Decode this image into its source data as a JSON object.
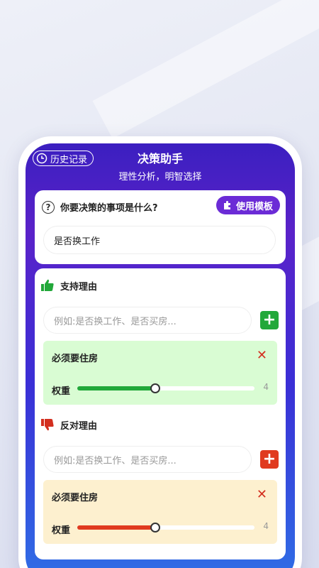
{
  "header": {
    "history_label": "历史记录",
    "title": "决策助手",
    "subtitle": "理性分析，明智选择"
  },
  "question": {
    "label": "你要决策的事项是什么?",
    "template_button": "使用模板",
    "value": "是否换工作"
  },
  "pros": {
    "title": "支持理由",
    "placeholder": "例如:是否换工作、是否买房...",
    "add_label": "+",
    "items": [
      {
        "text": "必须要住房",
        "weight_label": "权重",
        "weight": 4,
        "slider_fraction": 0.44
      }
    ]
  },
  "cons": {
    "title": "反对理由",
    "placeholder": "例如:是否换工作、是否买房...",
    "add_label": "+",
    "items": [
      {
        "text": "必须要住房",
        "weight_label": "权重",
        "weight": 4,
        "slider_fraction": 0.44
      }
    ]
  },
  "colors": {
    "accent": "#6b2bd6",
    "pro": "#22a83a",
    "con": "#e03a1f",
    "pro_bg": "#d9fcd3",
    "con_bg": "#fdf0cf"
  },
  "icons": {
    "history": "clock-icon",
    "question": "question-circle-icon",
    "template": "puzzle-icon",
    "pros": "thumbs-up-icon",
    "cons": "thumbs-down-icon",
    "remove": "close-icon"
  }
}
